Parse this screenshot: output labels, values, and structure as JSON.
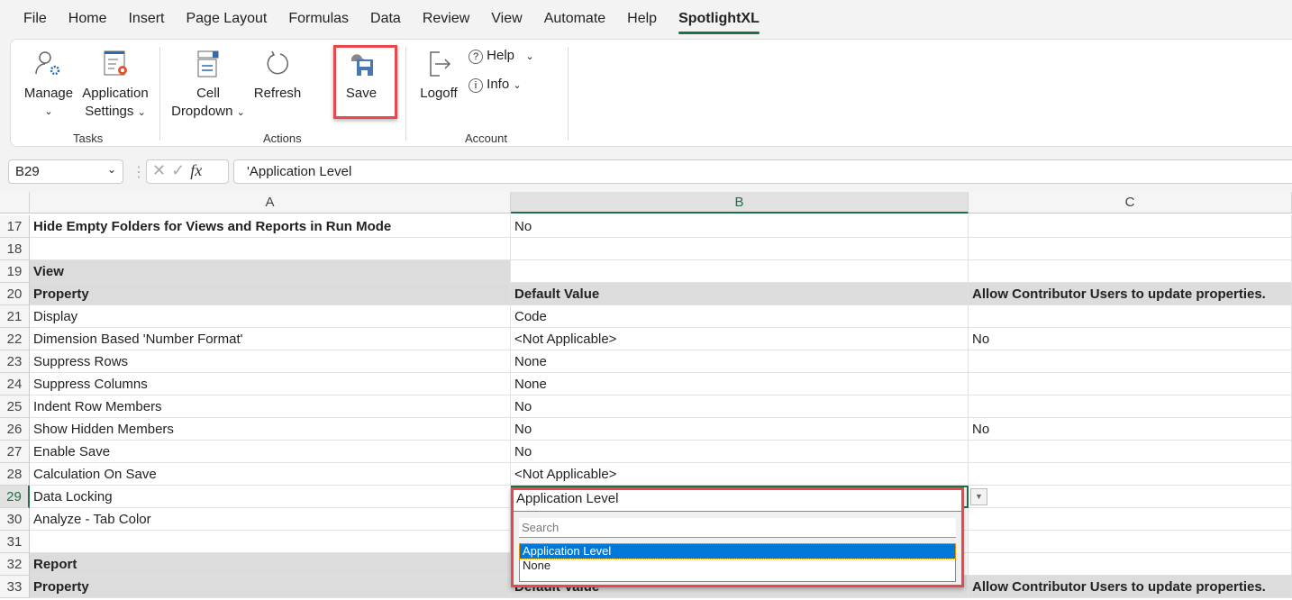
{
  "menu": [
    "File",
    "Home",
    "Insert",
    "Page Layout",
    "Formulas",
    "Data",
    "Review",
    "View",
    "Automate",
    "Help",
    "SpotlightXL"
  ],
  "ribbon": {
    "manage": "Manage",
    "app_settings_1": "Application",
    "app_settings_2": "Settings",
    "tasks": "Tasks",
    "cell_dd_1": "Cell",
    "cell_dd_2": "Dropdown",
    "refresh": "Refresh",
    "save": "Save",
    "actions": "Actions",
    "logoff": "Logoff",
    "help": "Help",
    "info": "Info",
    "account": "Account"
  },
  "formula": {
    "name_box": "B29",
    "value": "'Application Level"
  },
  "columns": [
    "A",
    "B",
    "C"
  ],
  "selected_cell": "B29",
  "rows": [
    {
      "n": "17",
      "a": "Hide Empty Folders for Views and Reports in Run Mode",
      "b": "No",
      "c": "",
      "style": "boldA"
    },
    {
      "n": "18",
      "a": "",
      "b": "",
      "c": ""
    },
    {
      "n": "19",
      "a": "View",
      "b": "",
      "c": "",
      "style": "sectionA"
    },
    {
      "n": "20",
      "a": "Property",
      "b": "Default Value",
      "c": "Allow Contributor Users to update properties.",
      "style": "header"
    },
    {
      "n": "21",
      "a": "Display",
      "b": "Code",
      "c": ""
    },
    {
      "n": "22",
      "a": "Dimension Based 'Number Format'",
      "b": "<Not Applicable>",
      "c": "No"
    },
    {
      "n": "23",
      "a": "Suppress Rows",
      "b": "None",
      "c": ""
    },
    {
      "n": "24",
      "a": "Suppress Columns",
      "b": "None",
      "c": ""
    },
    {
      "n": "25",
      "a": "Indent Row Members",
      "b": "No",
      "c": ""
    },
    {
      "n": "26",
      "a": "Show Hidden Members",
      "b": "No",
      "c": "No"
    },
    {
      "n": "27",
      "a": "Enable Save",
      "b": "No",
      "c": ""
    },
    {
      "n": "28",
      "a": "Calculation On Save",
      "b": "<Not Applicable>",
      "c": ""
    },
    {
      "n": "29",
      "a": "Data Locking",
      "b": "Application Level",
      "c": ""
    },
    {
      "n": "30",
      "a": "Analyze - Tab Color",
      "b": "",
      "c": ""
    },
    {
      "n": "31",
      "a": "",
      "b": "",
      "c": ""
    },
    {
      "n": "32",
      "a": "Report",
      "b": "",
      "c": "",
      "style": "sectionA"
    },
    {
      "n": "33",
      "a": "Property",
      "b": "Default Value",
      "c": "Allow Contributor Users to update properties.",
      "style": "header"
    }
  ],
  "dropdown": {
    "value": "Application Level",
    "search_placeholder": "Search",
    "options": [
      "Application Level",
      "None"
    ],
    "selected": "Application Level"
  },
  "colors": {
    "accent": "#1e7145",
    "highlight": "#e8474c",
    "selection": "#0078d7"
  }
}
